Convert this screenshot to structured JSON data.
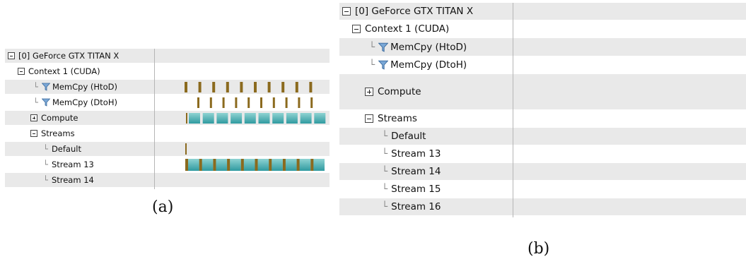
{
  "captions": {
    "a": "(a)",
    "b": "(b)"
  },
  "colors": {
    "memcpy": "#8b6a1e",
    "kernel": "#2f9aa0",
    "kernel_light": "#8fd3d2",
    "row_shade": "#e9e9e9",
    "divider": "#b5b5b5"
  },
  "icons": {
    "expand": "plus-box-icon",
    "collapse": "minus-box-icon",
    "filter": "funnel-icon",
    "tree": "tree-connector-icon"
  },
  "panel_a": {
    "rows": [
      {
        "label": "[0] GeForce GTX TITAN X",
        "icon": "collapse"
      },
      {
        "label": "Context 1 (CUDA)",
        "icon": "collapse"
      },
      {
        "label": "MemCpy (HtoD)",
        "icon": "filter"
      },
      {
        "label": "MemCpy (DtoH)",
        "icon": "filter"
      },
      {
        "label": "Compute",
        "icon": "expand"
      },
      {
        "label": "Streams",
        "icon": "collapse"
      },
      {
        "label": "Default",
        "icon": "tree"
      },
      {
        "label": "Stream 13",
        "icon": "tree"
      },
      {
        "label": "Stream 14",
        "icon": "tree"
      }
    ]
  },
  "panel_b": {
    "rows": [
      {
        "label": "[0] GeForce GTX TITAN X",
        "icon": "collapse"
      },
      {
        "label": "Context 1 (CUDA)",
        "icon": "collapse"
      },
      {
        "label": "MemCpy (HtoD)",
        "icon": "filter"
      },
      {
        "label": "MemCpy (DtoH)",
        "icon": "filter"
      },
      {
        "label": "Compute",
        "icon": "expand"
      },
      {
        "label": "Streams",
        "icon": "collapse"
      },
      {
        "label": "Default",
        "icon": "tree"
      },
      {
        "label": "Stream 13",
        "icon": "tree"
      },
      {
        "label": "Stream 14",
        "icon": "tree"
      },
      {
        "label": "Stream 15",
        "icon": "tree"
      },
      {
        "label": "Stream 16",
        "icon": "tree"
      }
    ]
  }
}
